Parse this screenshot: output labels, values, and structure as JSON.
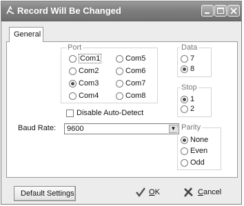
{
  "window": {
    "title": "Record Will Be Changed",
    "app_icon": "app-icon"
  },
  "tabs": [
    {
      "label": "General"
    }
  ],
  "port": {
    "label": "Port",
    "options": [
      "Com1",
      "Com2",
      "Com3",
      "Com4",
      "Com5",
      "Com6",
      "Com7",
      "Com8"
    ],
    "selected": "Com3"
  },
  "disable_auto_detect": {
    "label": "Disable Auto-Detect",
    "checked": false
  },
  "baud_rate": {
    "label": "Baud Rate:",
    "value": "9600"
  },
  "data": {
    "label": "Data",
    "options": [
      "7",
      "8"
    ],
    "selected": "8"
  },
  "stop": {
    "label": "Stop",
    "options": [
      "1",
      "2"
    ],
    "selected": "1"
  },
  "parity": {
    "label": "Parity",
    "options": [
      "None",
      "Even",
      "Odd"
    ],
    "selected": "None"
  },
  "buttons": {
    "default_settings": "Default Settings",
    "ok_pre": "",
    "ok_mnemonic": "O",
    "ok_post": "K",
    "cancel_pre": "",
    "cancel_mnemonic": "C",
    "cancel_post": "ancel"
  },
  "colors": {
    "titlebar": "#7f7f7f",
    "dialog_bg": "#ececec",
    "panel_bg": "#ffffff"
  }
}
